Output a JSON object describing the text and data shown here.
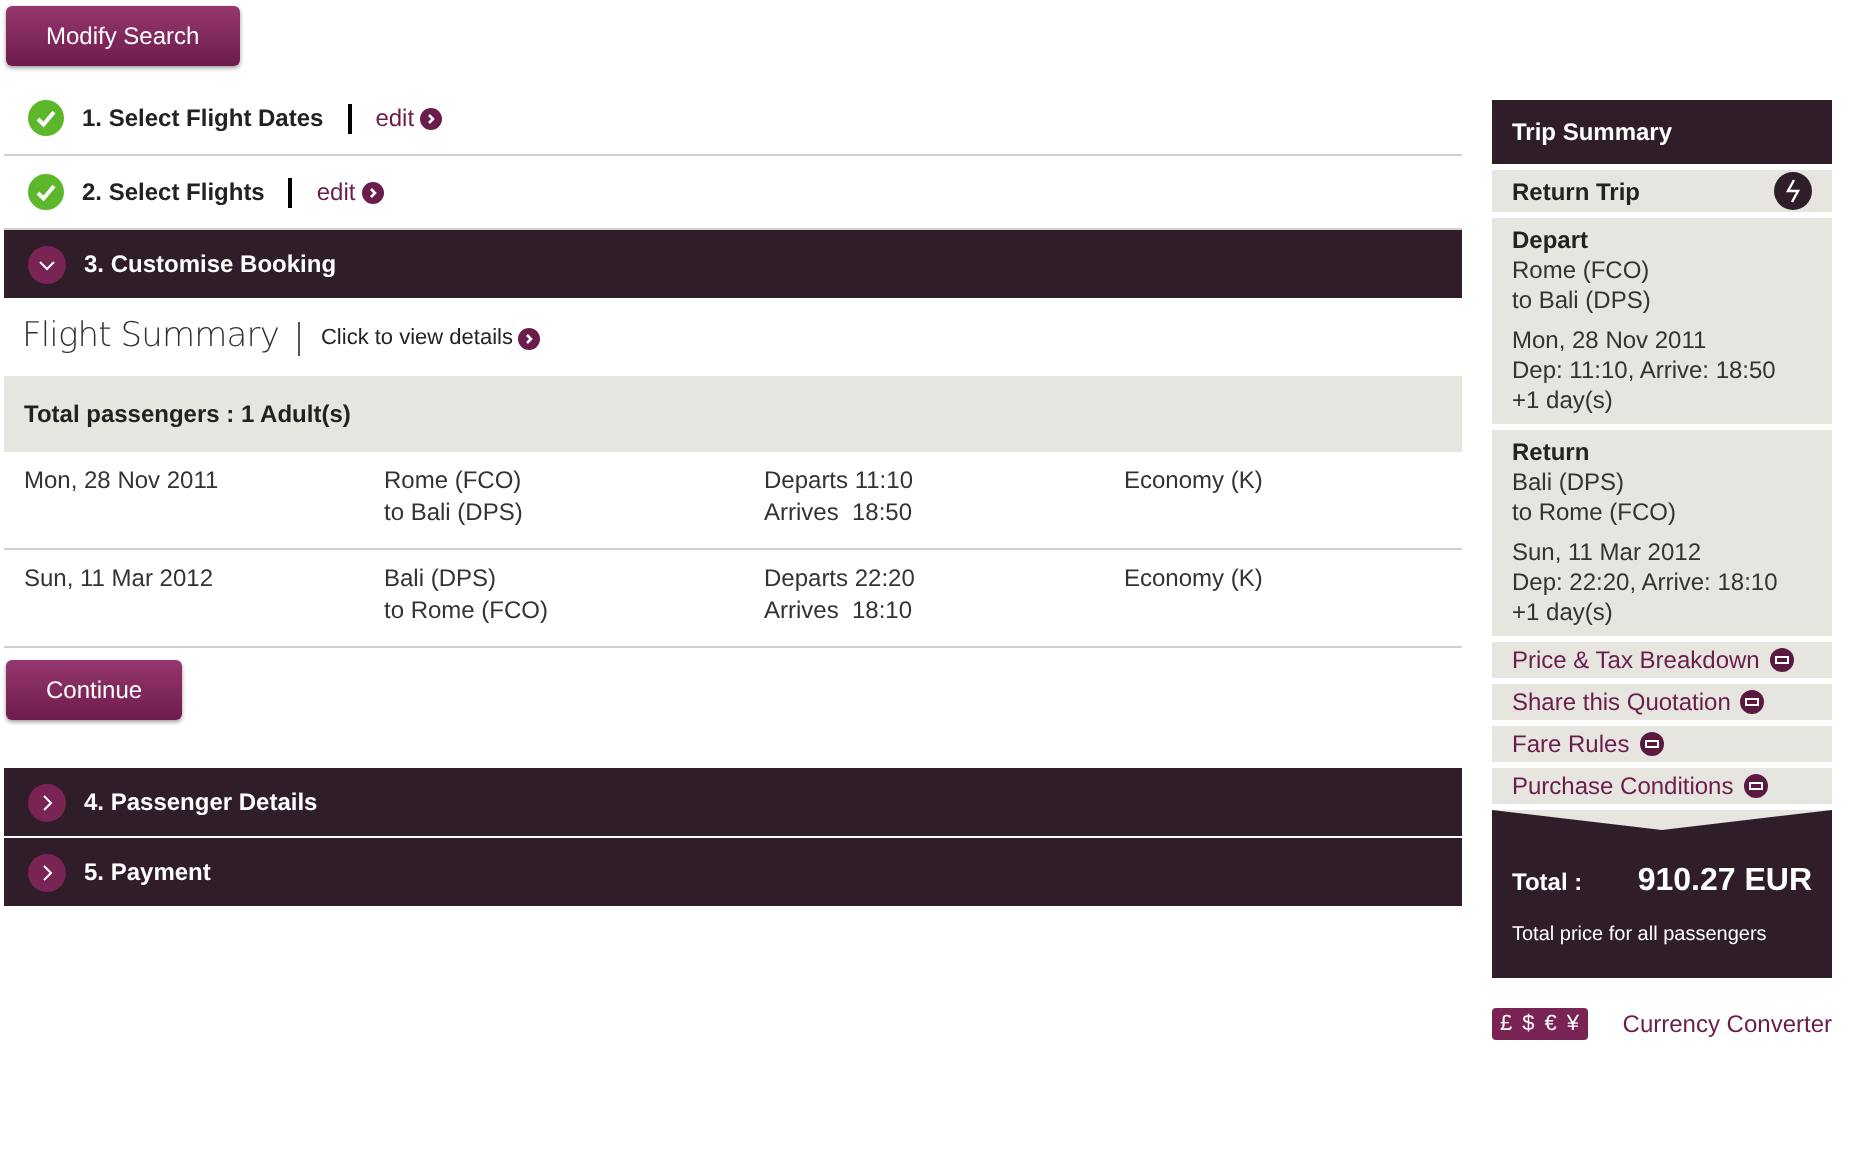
{
  "modify_button": "Modify Search",
  "steps_before": [
    {
      "kind": "done",
      "label": "1. Select Flight Dates",
      "link": "edit"
    },
    {
      "kind": "done",
      "label": "2. Select Flights",
      "link": "edit"
    },
    {
      "kind": "section",
      "label": "3. Customise Booking",
      "expanded": true
    }
  ],
  "flight_summary": {
    "title": "Flight Summary",
    "link": "Click to view details",
    "passengers": "Total passengers : 1 Adult(s)",
    "rows": [
      {
        "date": "Mon, 28 Nov 2011",
        "from": "Rome (FCO)",
        "to": "to Bali (DPS)",
        "departs": "Departs 11:10",
        "arrives": "Arrives  18:50",
        "cabin": "Economy (K)"
      },
      {
        "date": "Sun, 11 Mar 2012",
        "from": "Bali (DPS)",
        "to": "to Rome (FCO)",
        "departs": "Departs 22:20",
        "arrives": "Arrives  18:10",
        "cabin": "Economy (K)"
      }
    ]
  },
  "continue_button": "Continue",
  "steps_after": [
    {
      "kind": "section",
      "label": "4. Passenger Details",
      "expanded": false
    },
    {
      "kind": "section",
      "label": "5. Payment",
      "expanded": false
    }
  ],
  "trip_summary": {
    "title": "Trip Summary",
    "trip_type": "Return Trip",
    "legs": [
      {
        "heading": "Depart",
        "route": [
          "Rome (FCO)",
          "to Bali (DPS)"
        ],
        "times": [
          "Mon, 28 Nov 2011",
          "Dep: 11:10, Arrive: 18:50",
          "+1 day(s)"
        ]
      },
      {
        "heading": "Return",
        "route": [
          "Bali (DPS)",
          "to Rome (FCO)"
        ],
        "times": [
          "Sun, 11 Mar 2012",
          "Dep: 22:20, Arrive: 18:10",
          "+1 day(s)"
        ]
      }
    ],
    "links": [
      "Price & Tax Breakdown",
      "Share this Quotation",
      "Fare Rules",
      "Purchase Conditions"
    ],
    "total_label": "Total :",
    "total_value": "910.27 EUR",
    "total_note": "Total price for all passengers"
  },
  "currency": {
    "symbols": [
      "£",
      "$",
      "€",
      "¥"
    ],
    "link": "Currency Converter"
  }
}
